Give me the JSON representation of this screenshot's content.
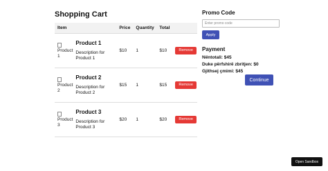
{
  "cart": {
    "title": "Shopping Cart",
    "headers": {
      "item": "Item",
      "price": "Price",
      "quantity": "Quantity",
      "total": "Total"
    },
    "items": [
      {
        "image_alt": "Product 1",
        "name": "Product 1",
        "description": "Description for Product 1",
        "price": "$10",
        "quantity": "1",
        "total": "$10",
        "remove_label": "Remove"
      },
      {
        "image_alt": "Product 2",
        "name": "Product 2",
        "description": "Description for Product 2",
        "price": "$15",
        "quantity": "1",
        "total": "$15",
        "remove_label": "Remove"
      },
      {
        "image_alt": "Product 3",
        "name": "Product 3",
        "description": "Description for Product 3",
        "price": "$20",
        "quantity": "1",
        "total": "$20",
        "remove_label": "Remove"
      }
    ]
  },
  "promo": {
    "title": "Promo Code",
    "placeholder": "Enter promo code",
    "value": "",
    "apply_label": "Apply"
  },
  "payment": {
    "title": "Payment",
    "subtotal": "Nëntotali: $45",
    "discount": "Duke përfshirë zbritjen: $0",
    "total": "Gjithsej çmimi: $45",
    "continue_label": "Continue"
  },
  "sandbox": {
    "label": "Open Sandbox"
  },
  "colors": {
    "remove": "#e53935",
    "primary": "#3f51b5",
    "header_bg": "#f2f2f2",
    "sandbox_bg": "#111111"
  }
}
